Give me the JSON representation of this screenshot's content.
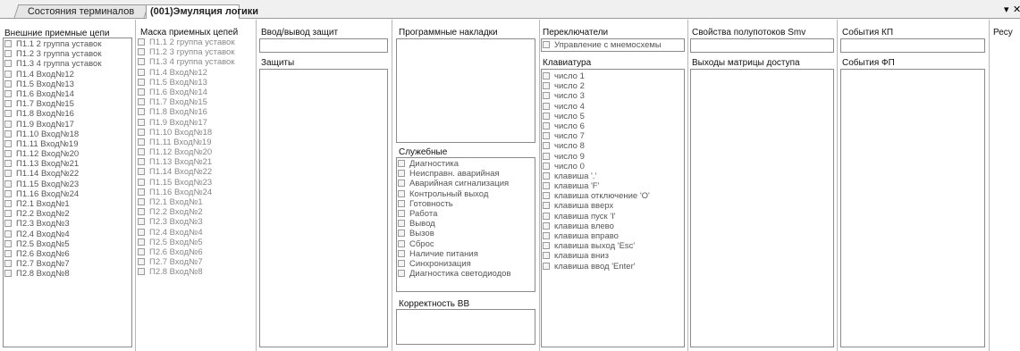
{
  "tabs": [
    {
      "label": "Состояния терминалов"
    },
    {
      "label": "(001)Эмуляция логики"
    }
  ],
  "window_controls": {
    "dropdown": "▾",
    "close": "✕"
  },
  "col1": {
    "title": "Внешние приемные цепи",
    "items": [
      "П1.1 2 группа уставок",
      "П1.2 3 группа уставок",
      "П1.3 4 группа уставок",
      "П1.4 Вход№12",
      "П1.5 Вход№13",
      "П1.6 Вход№14",
      "П1.7 Вход№15",
      "П1.8 Вход№16",
      "П1.9 Вход№17",
      "П1.10 Вход№18",
      "П1.11 Вход№19",
      "П1.12 Вход№20",
      "П1.13 Вход№21",
      "П1.14 Вход№22",
      "П1.15 Вход№23",
      "П1.16 Вход№24",
      "П2.1 Вход№1",
      "П2.2 Вход№2",
      "П2.3 Вход№3",
      "П2.4 Вход№4",
      "П2.5 Вход№5",
      "П2.6 Вход№6",
      "П2.7 Вход№7",
      "П2.8 Вход№8"
    ]
  },
  "col2": {
    "title": "Маска приемных цепей",
    "items": [
      "П1.1 2 группа уставок",
      "П1.2 3 группа уставок",
      "П1.3 4 группа уставок",
      "П1.4 Вход№12",
      "П1.5 Вход№13",
      "П1.6 Вход№14",
      "П1.7 Вход№15",
      "П1.8 Вход№16",
      "П1.9 Вход№17",
      "П1.10 Вход№18",
      "П1.11 Вход№19",
      "П1.12 Вход№20",
      "П1.13 Вход№21",
      "П1.14 Вход№22",
      "П1.15 Вход№23",
      "П1.16 Вход№24",
      "П2.1 Вход№1",
      "П2.2 Вход№2",
      "П2.3 Вход№3",
      "П2.4 Вход№4",
      "П2.5 Вход№5",
      "П2.6 Вход№6",
      "П2.7 Вход№7",
      "П2.8 Вход№8"
    ]
  },
  "col3": {
    "title": "Ввод/вывод защит",
    "input_value": "",
    "protections_title": "Защиты"
  },
  "col4": {
    "title": "Программные накладки",
    "service_title": "Служебные",
    "service_items": [
      "Диагностика",
      "Неисправн. аварийная",
      "Аварийная сигнализация",
      "Контрольный выход",
      "Готовность",
      "Работа",
      "Вывод",
      "Вызов",
      "Сброс",
      "Наличие питания",
      "Синхронизация",
      "Диагностика светодиодов"
    ],
    "bb_title": "Корректность ВВ"
  },
  "col5": {
    "title": "Переключатели",
    "switch_item": "Управление с мнемосхемы",
    "keyboard_title": "Клавиатура",
    "keyboard_items": [
      "число 1",
      "число 2",
      "число 3",
      "число 4",
      "число 5",
      "число 6",
      "число 7",
      "число 8",
      "число 9",
      "число 0",
      "клавиша '.'",
      "клавиша 'F'",
      "клавиша отключение 'O'",
      "клавиша вверх",
      "клавиша пуск 'I'",
      "клавиша влево",
      "клавиша вправо",
      "клавиша выход 'Esc'",
      "клавиша вниз",
      "клавиша ввод 'Enter'"
    ]
  },
  "col6": {
    "title": "Свойства полупотоков Smv",
    "input_value": "",
    "outputs_title": "Выходы матрицы доступа"
  },
  "col7": {
    "title": "События КП",
    "input_value": "",
    "fp_title": "События ФП"
  },
  "col8": {
    "title": "Ресу"
  }
}
